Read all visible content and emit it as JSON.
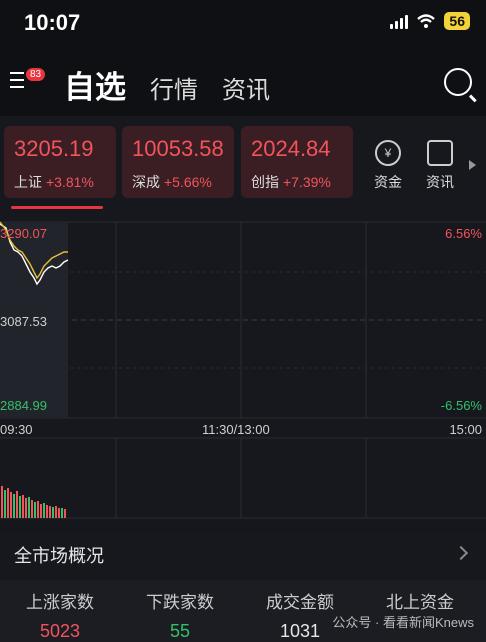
{
  "status": {
    "time": "10:07",
    "battery": "56"
  },
  "nav": {
    "badge": "83",
    "tabs": [
      "自选",
      "行情",
      "资讯"
    ]
  },
  "indices": [
    {
      "value": "3205.19",
      "name": "上证",
      "change": "+3.81%"
    },
    {
      "value": "10053.58",
      "name": "深成",
      "change": "+5.66%"
    },
    {
      "value": "2024.84",
      "name": "创指",
      "change": "+7.39%"
    }
  ],
  "quick_actions": [
    {
      "label": "资金",
      "icon": "yuan-icon",
      "glyph": "¥"
    },
    {
      "label": "资讯",
      "icon": "document-icon",
      "glyph": ""
    }
  ],
  "chart": {
    "left_top": "3290.07",
    "left_mid": "3087.53",
    "left_bot": "2884.99",
    "right_top": "6.56%",
    "right_bot": "-6.56%",
    "time_start": "09:30",
    "time_mid": "11:30/13:00",
    "time_end": "15:00"
  },
  "overview": {
    "title": "全市场概况",
    "metrics": [
      {
        "label": "上涨家数",
        "value": "5023",
        "color": "#f2545b"
      },
      {
        "label": "下跌家数",
        "value": "55",
        "color": "#35c06a"
      },
      {
        "label": "成交金额",
        "value": "1031",
        "color": "#e6e6e6"
      },
      {
        "label": "北上资金",
        "value": "",
        "color": "#e6e6e6"
      }
    ]
  },
  "watermark": "公众号 · 看看新闻Knews",
  "colors": {
    "up": "#f2545b",
    "down": "#35c06a",
    "card_bg": "#3a1e23"
  }
}
